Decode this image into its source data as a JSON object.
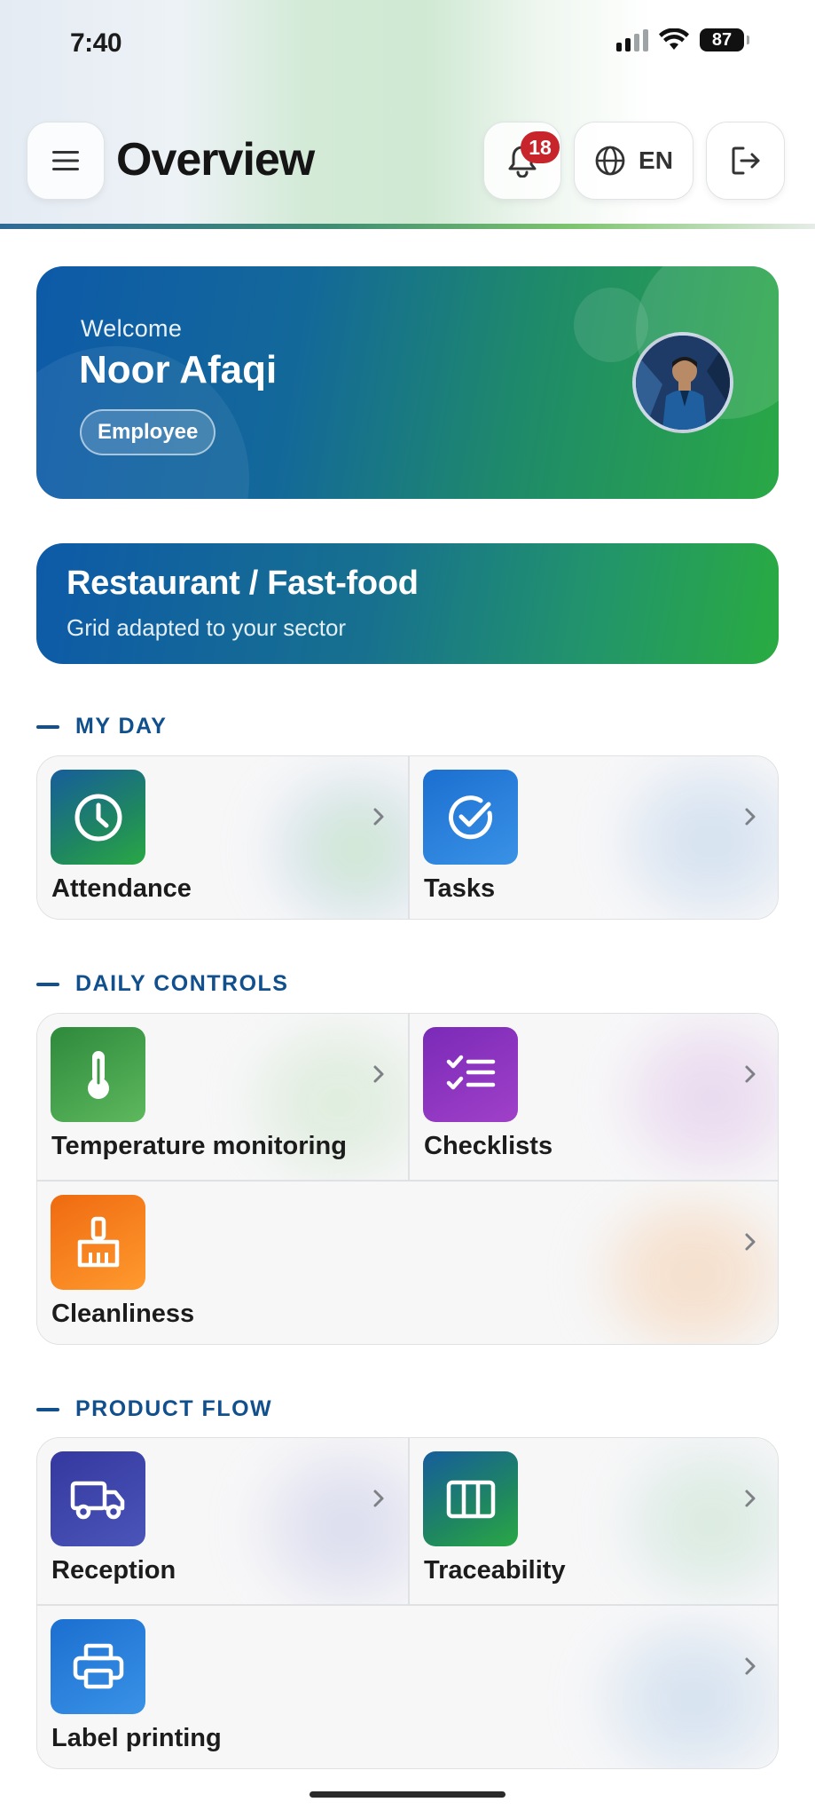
{
  "status_bar": {
    "time": "7:40",
    "battery": "87"
  },
  "header": {
    "title": "Overview",
    "notification_count": "18",
    "language": "EN"
  },
  "welcome_card": {
    "greeting": "Welcome",
    "name": "Noor Afaqi",
    "role": "Employee"
  },
  "sector_card": {
    "title": "Restaurant / Fast-food",
    "subtitle": "Grid adapted to your sector"
  },
  "sections": {
    "my_day": {
      "title": "MY DAY",
      "tiles": [
        {
          "label": "Attendance",
          "icon": "clock-icon"
        },
        {
          "label": "Tasks",
          "icon": "check-circle-icon"
        }
      ]
    },
    "daily_controls": {
      "title": "DAILY CONTROLS",
      "tiles": [
        {
          "label": "Temperature monitoring",
          "icon": "thermometer-icon"
        },
        {
          "label": "Checklists",
          "icon": "checklist-icon"
        },
        {
          "label": "Cleanliness",
          "icon": "broom-icon"
        }
      ]
    },
    "product_flow": {
      "title": "PRODUCT FLOW",
      "tiles": [
        {
          "label": "Reception",
          "icon": "truck-icon"
        },
        {
          "label": "Traceability",
          "icon": "barcode-icon"
        },
        {
          "label": "Label printing",
          "icon": "printer-icon"
        }
      ]
    }
  },
  "colors": {
    "brand_blue": "#0d5aa8",
    "brand_green": "#2aa845",
    "section_heading": "#114f8d",
    "badge_red": "#c8242b"
  }
}
